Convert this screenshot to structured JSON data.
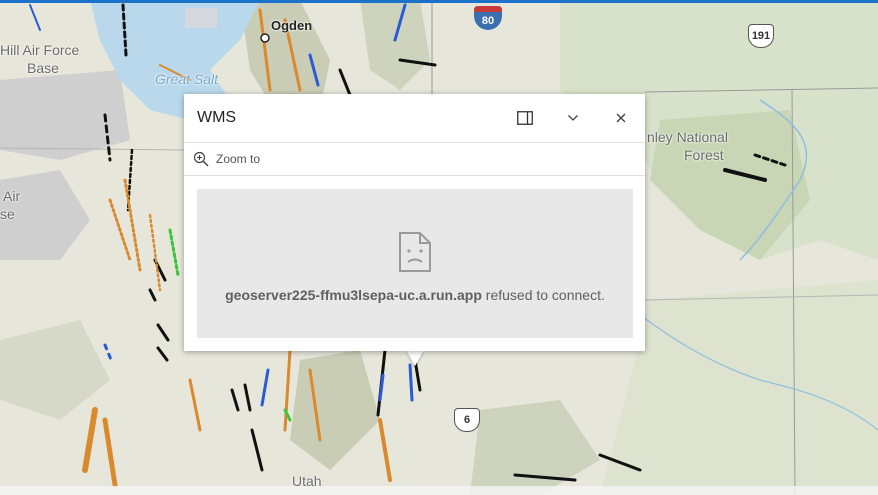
{
  "map": {
    "labels": {
      "hill_afb": "Hill Air Force",
      "hill_afb_2": "Base",
      "great_salt": "Great Salt",
      "ogden": "Ogden",
      "air_1": "Air",
      "air_2": "se",
      "forest_1": "nley National",
      "forest_2": "Forest",
      "utah": "Utah"
    },
    "shields": {
      "i80": "80",
      "us191": "191",
      "us6": "6"
    }
  },
  "popup": {
    "title": "WMS",
    "dock_icon": "dock-icon",
    "collapse_icon": "chevron-down-icon",
    "close_icon": "close-icon",
    "zoom_label": "Zoom to",
    "error": {
      "host": "geoserver225-ffmu3lsepa-uc.a.run.app",
      "message": " refused to connect."
    }
  },
  "colors": {
    "accent": "#1a73c8",
    "water": "#b9d8ec",
    "fault_black": "#111111",
    "fault_orange": "#d9892e",
    "fault_blue": "#2a5ad6",
    "fault_green": "#3cc43c"
  }
}
